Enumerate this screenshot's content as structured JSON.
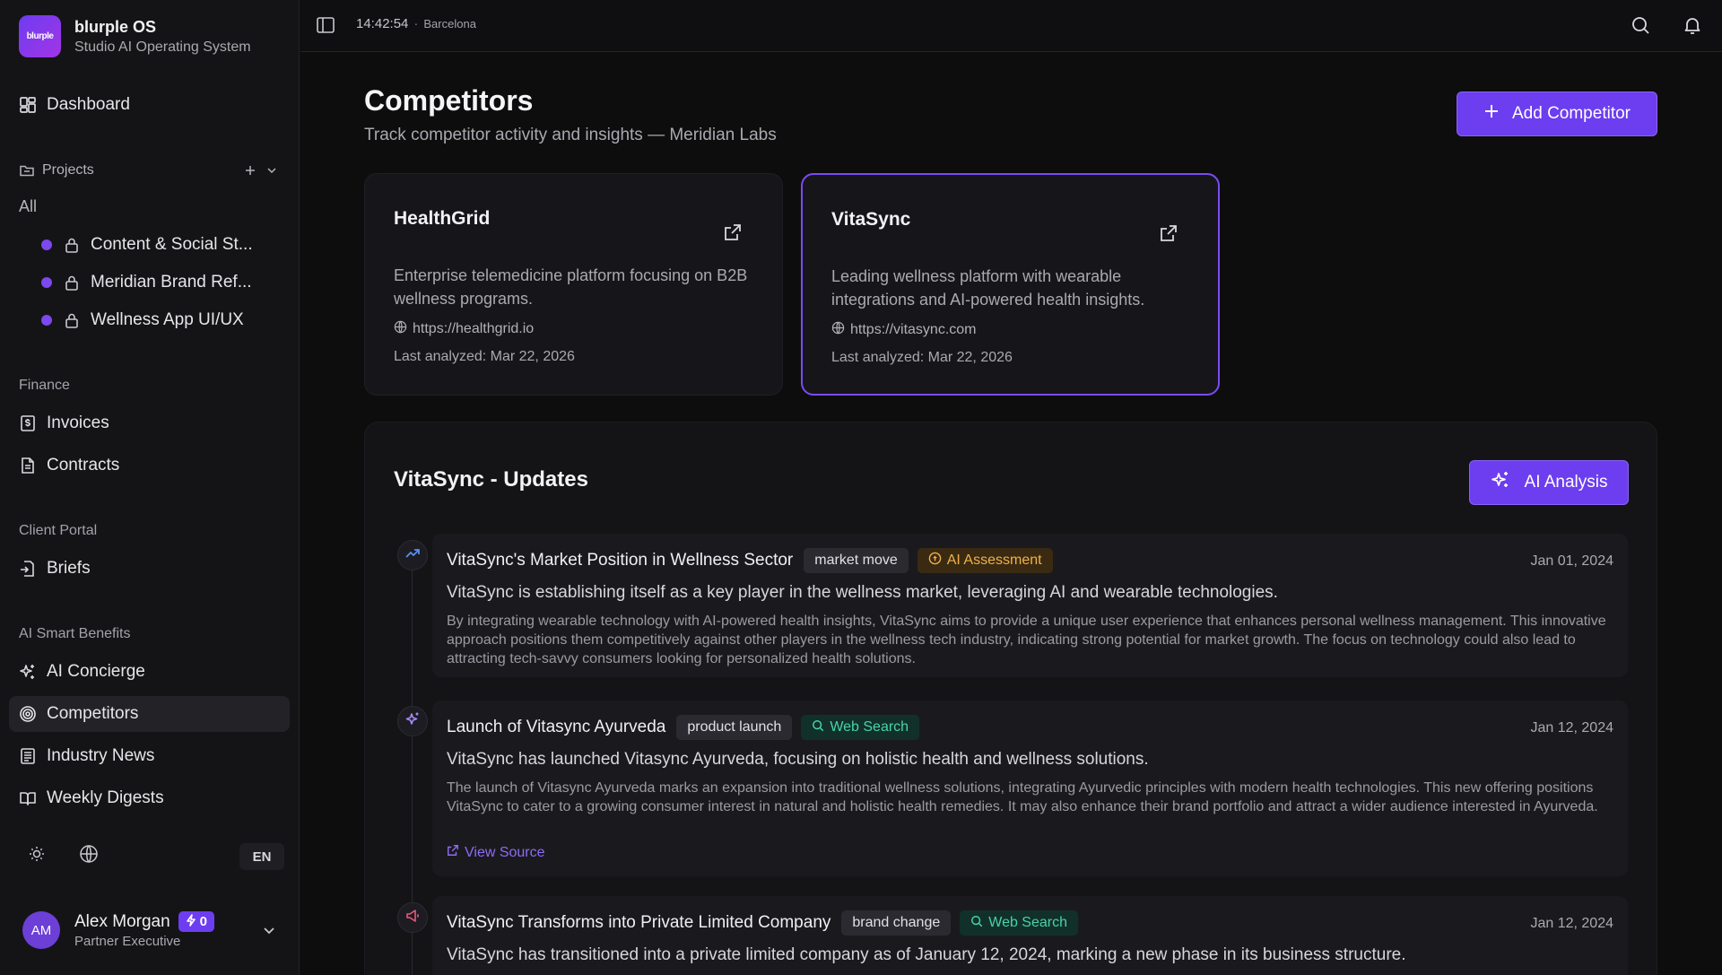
{
  "brand": {
    "logo_text": "blurple",
    "name": "blurple OS",
    "subtitle": "Studio AI Operating System"
  },
  "sidebar": {
    "dashboard": "Dashboard",
    "projects_label": "Projects",
    "projects_all": "All",
    "projects": [
      {
        "label": "Content & Social St..."
      },
      {
        "label": "Meridian Brand Ref..."
      },
      {
        "label": "Wellness App UI/UX"
      }
    ],
    "finance_label": "Finance",
    "invoices": "Invoices",
    "contracts": "Contracts",
    "client_portal_label": "Client Portal",
    "briefs": "Briefs",
    "ai_benefits_label": "AI Smart Benefits",
    "ai_concierge": "AI Concierge",
    "competitors": "Competitors",
    "industry_news": "Industry News",
    "weekly_digests": "Weekly Digests",
    "language": "EN"
  },
  "user": {
    "initials": "AM",
    "name": "Alex Morgan",
    "credits": "0",
    "role": "Partner Executive"
  },
  "topbar": {
    "time": "14:42:54",
    "separator": "·",
    "city": "Barcelona"
  },
  "page": {
    "title": "Competitors",
    "subtitle": "Track competitor activity and insights — Meridian Labs",
    "add_button": "Add Competitor"
  },
  "competitors": [
    {
      "name": "HealthGrid",
      "description": "Enterprise telemedicine platform focusing on B2B wellness programs.",
      "url": "https://healthgrid.io",
      "last_analyzed": "Last analyzed: Mar 22, 2026"
    },
    {
      "name": "VitaSync",
      "description": "Leading wellness platform with wearable integrations and AI-powered health insights.",
      "url": "https://vitasync.com",
      "last_analyzed": "Last analyzed: Mar 22, 2026"
    }
  ],
  "updates": {
    "title": "VitaSync - Updates",
    "ai_button": "AI Analysis",
    "items": [
      {
        "title": "VitaSync's Market Position in Wellness Sector",
        "tag": "market move",
        "source": "AI Assessment",
        "date": "Jan 01, 2024",
        "summary": "VitaSync is establishing itself as a key player in the wellness market, leveraging AI and wearable technologies.",
        "detail": "By integrating wearable technology with AI-powered health insights, VitaSync aims to provide a unique user experience that enhances personal wellness management. This innovative approach positions them competitively against other players in the wellness tech industry, indicating strong potential for market growth. The focus on technology could also lead to attracting tech-savvy consumers looking for personalized health solutions."
      },
      {
        "title": "Launch of Vitasync Ayurveda",
        "tag": "product launch",
        "source": "Web Search",
        "date": "Jan 12, 2024",
        "summary": "VitaSync has launched Vitasync Ayurveda, focusing on holistic health and wellness solutions.",
        "detail": "The launch of Vitasync Ayurveda marks an expansion into traditional wellness solutions, integrating Ayurvedic principles with modern health technologies. This new offering positions VitaSync to cater to a growing consumer interest in natural and holistic health remedies. It may also enhance their brand portfolio and attract a wider audience interested in Ayurveda.",
        "link": "View Source"
      },
      {
        "title": "VitaSync Transforms into Private Limited Company",
        "tag": "brand change",
        "source": "Web Search",
        "date": "Jan 12, 2024",
        "summary": "VitaSync has transitioned into a private limited company as of January 12, 2024, marking a new phase in its business structure."
      }
    ]
  },
  "colors": {
    "accent": "#6d3df0",
    "ai_source": "#f0b14a",
    "web_source": "#48d3a8"
  }
}
